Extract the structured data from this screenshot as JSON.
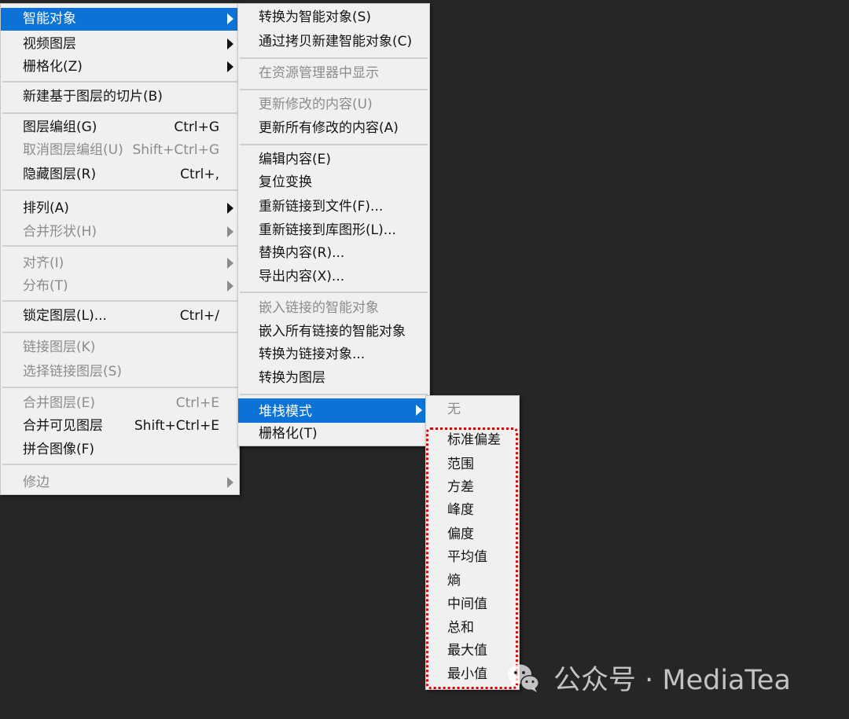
{
  "layer_menu": {
    "items": [
      {
        "label": "智能对象",
        "shortcut": "",
        "submenu": true,
        "state": "highlighted"
      },
      {
        "label": "视频图层",
        "shortcut": "",
        "submenu": true,
        "state": "enabled"
      },
      {
        "label": "栅格化(Z)",
        "shortcut": "",
        "submenu": true,
        "state": "enabled"
      },
      {
        "label": "新建基于图层的切片(B)",
        "shortcut": "",
        "submenu": false,
        "state": "enabled"
      },
      {
        "label": "图层编组(G)",
        "shortcut": "Ctrl+G",
        "submenu": false,
        "state": "enabled"
      },
      {
        "label": "取消图层编组(U)",
        "shortcut": "Shift+Ctrl+G",
        "submenu": false,
        "state": "disabled"
      },
      {
        "label": "隐藏图层(R)",
        "shortcut": "Ctrl+,",
        "submenu": false,
        "state": "enabled"
      },
      {
        "label": "排列(A)",
        "shortcut": "",
        "submenu": true,
        "state": "enabled"
      },
      {
        "label": "合并形状(H)",
        "shortcut": "",
        "submenu": true,
        "state": "disabled"
      },
      {
        "label": "对齐(I)",
        "shortcut": "",
        "submenu": true,
        "state": "disabled"
      },
      {
        "label": "分布(T)",
        "shortcut": "",
        "submenu": true,
        "state": "disabled"
      },
      {
        "label": "锁定图层(L)...",
        "shortcut": "Ctrl+/",
        "submenu": false,
        "state": "enabled"
      },
      {
        "label": "链接图层(K)",
        "shortcut": "",
        "submenu": false,
        "state": "disabled"
      },
      {
        "label": "选择链接图层(S)",
        "shortcut": "",
        "submenu": false,
        "state": "disabled"
      },
      {
        "label": "合并图层(E)",
        "shortcut": "Ctrl+E",
        "submenu": false,
        "state": "disabled"
      },
      {
        "label": "合并可见图层",
        "shortcut": "Shift+Ctrl+E",
        "submenu": false,
        "state": "enabled"
      },
      {
        "label": "拼合图像(F)",
        "shortcut": "",
        "submenu": false,
        "state": "enabled"
      },
      {
        "label": "修边",
        "shortcut": "",
        "submenu": true,
        "state": "disabled"
      }
    ]
  },
  "smart_object_menu": {
    "items": [
      {
        "label": "转换为智能对象(S)",
        "submenu": false,
        "state": "enabled"
      },
      {
        "label": "通过拷贝新建智能对象(C)",
        "submenu": false,
        "state": "enabled"
      },
      {
        "label": "在资源管理器中显示",
        "submenu": false,
        "state": "disabled"
      },
      {
        "label": "更新修改的内容(U)",
        "submenu": false,
        "state": "disabled"
      },
      {
        "label": "更新所有修改的内容(A)",
        "submenu": false,
        "state": "enabled"
      },
      {
        "label": "编辑内容(E)",
        "submenu": false,
        "state": "enabled"
      },
      {
        "label": "复位变换",
        "submenu": false,
        "state": "enabled"
      },
      {
        "label": "重新链接到文件(F)...",
        "submenu": false,
        "state": "enabled"
      },
      {
        "label": "重新链接到库图形(L)...",
        "submenu": false,
        "state": "enabled"
      },
      {
        "label": "替换内容(R)...",
        "submenu": false,
        "state": "enabled"
      },
      {
        "label": "导出内容(X)...",
        "submenu": false,
        "state": "enabled"
      },
      {
        "label": "嵌入链接的智能对象",
        "submenu": false,
        "state": "disabled"
      },
      {
        "label": "嵌入所有链接的智能对象",
        "submenu": false,
        "state": "enabled"
      },
      {
        "label": "转换为链接对象...",
        "submenu": false,
        "state": "enabled"
      },
      {
        "label": "转换为图层",
        "submenu": false,
        "state": "enabled"
      },
      {
        "label": "堆栈模式",
        "submenu": true,
        "state": "highlighted"
      },
      {
        "label": "栅格化(T)",
        "submenu": false,
        "state": "enabled"
      }
    ]
  },
  "stack_mode_menu": {
    "items": [
      {
        "label": "无",
        "state": "disabled"
      },
      {
        "label": "标准偏差",
        "state": "enabled"
      },
      {
        "label": "范围",
        "state": "enabled"
      },
      {
        "label": "方差",
        "state": "enabled"
      },
      {
        "label": "峰度",
        "state": "enabled"
      },
      {
        "label": "偏度",
        "state": "enabled"
      },
      {
        "label": "平均值",
        "state": "enabled"
      },
      {
        "label": "熵",
        "state": "enabled"
      },
      {
        "label": "中间值",
        "state": "enabled"
      },
      {
        "label": "总和",
        "state": "enabled"
      },
      {
        "label": "最大值",
        "state": "enabled"
      },
      {
        "label": "最小值",
        "state": "enabled"
      }
    ]
  },
  "watermark": {
    "icon": "wechat-icon",
    "text": "公众号 · MediaTea"
  },
  "colors": {
    "background": "#262626",
    "menu_bg": "#f0f0f0",
    "highlight": "#0b73d6",
    "disabled_text": "#8c8c8c",
    "annotation_red": "#d40000"
  }
}
